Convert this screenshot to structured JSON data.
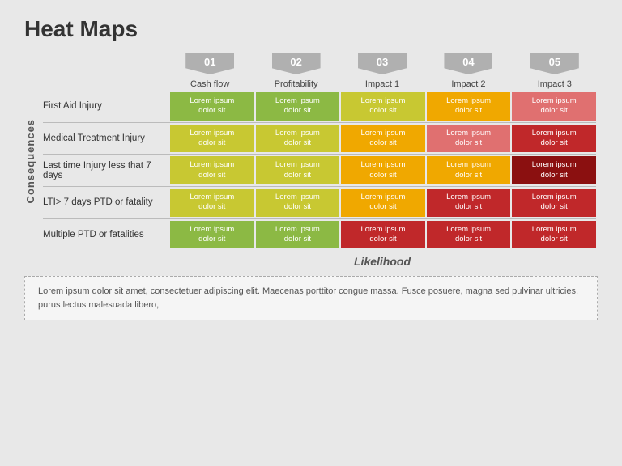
{
  "title": "Heat Maps",
  "consequences_label": "Consequences",
  "likelihood_label": "Likelihood",
  "col_headers": [
    {
      "badge": "01",
      "label": "Cash flow"
    },
    {
      "badge": "02",
      "label": "Profitability"
    },
    {
      "badge": "03",
      "label": "Impact 1"
    },
    {
      "badge": "04",
      "label": "Impact 2"
    },
    {
      "badge": "05",
      "label": "Impact 3"
    }
  ],
  "rows": [
    {
      "label": "First Aid Injury",
      "cells": [
        {
          "text": "Lorem ipsum dolor sit",
          "color": "c1"
        },
        {
          "text": "Lorem ipsum dolor sit",
          "color": "c1"
        },
        {
          "text": "Lorem ipsum dolor sit",
          "color": "c2"
        },
        {
          "text": "Lorem ipsum dolor sit",
          "color": "c3"
        },
        {
          "text": "Lorem ipsum dolor sit",
          "color": "c4"
        }
      ]
    },
    {
      "label": "Medical Treatment Injury",
      "cells": [
        {
          "text": "Lorem ipsum dolor sit",
          "color": "c2"
        },
        {
          "text": "Lorem ipsum dolor sit",
          "color": "c2"
        },
        {
          "text": "Lorem ipsum dolor sit",
          "color": "c3"
        },
        {
          "text": "Lorem ipsum dolor sit",
          "color": "c4"
        },
        {
          "text": "Lorem ipsum dolor sit",
          "color": "c5"
        }
      ]
    },
    {
      "label": "Last time Injury less that 7 days",
      "cells": [
        {
          "text": "Lorem ipsum dolor sit",
          "color": "c2"
        },
        {
          "text": "Lorem ipsum dolor sit",
          "color": "c2"
        },
        {
          "text": "Lorem ipsum dolor sit",
          "color": "c3"
        },
        {
          "text": "Lorem ipsum dolor sit",
          "color": "c3"
        },
        {
          "text": "Lorem ipsum dolor sit",
          "color": "c6"
        }
      ]
    },
    {
      "label": "LTI> 7 days PTD or fatality",
      "cells": [
        {
          "text": "Lorem ipsum dolor sit",
          "color": "c2"
        },
        {
          "text": "Lorem ipsum dolor sit",
          "color": "c2"
        },
        {
          "text": "Lorem ipsum dolor sit",
          "color": "c3"
        },
        {
          "text": "Lorem ipsum dolor sit",
          "color": "c5"
        },
        {
          "text": "Lorem ipsum dolor sit",
          "color": "c5"
        }
      ]
    },
    {
      "label": "Multiple PTD or fatalities",
      "cells": [
        {
          "text": "Lorem ipsum dolor sit",
          "color": "c1"
        },
        {
          "text": "Lorem ipsum dolor sit",
          "color": "c1"
        },
        {
          "text": "Lorem ipsum dolor sit",
          "color": "c5"
        },
        {
          "text": "Lorem ipsum dolor sit",
          "color": "c5"
        },
        {
          "text": "Lorem ipsum dolor sit",
          "color": "c5"
        }
      ]
    }
  ],
  "footer_text": "Lorem ipsum dolor sit amet, consectetuer adipiscing elit. Maecenas porttitor congue massa. Fusce posuere, magna sed pulvinar ultricies, purus lectus malesuada libero,",
  "cell_text_line1": "Lorem ipsum",
  "cell_text_line2": "dolor sit"
}
